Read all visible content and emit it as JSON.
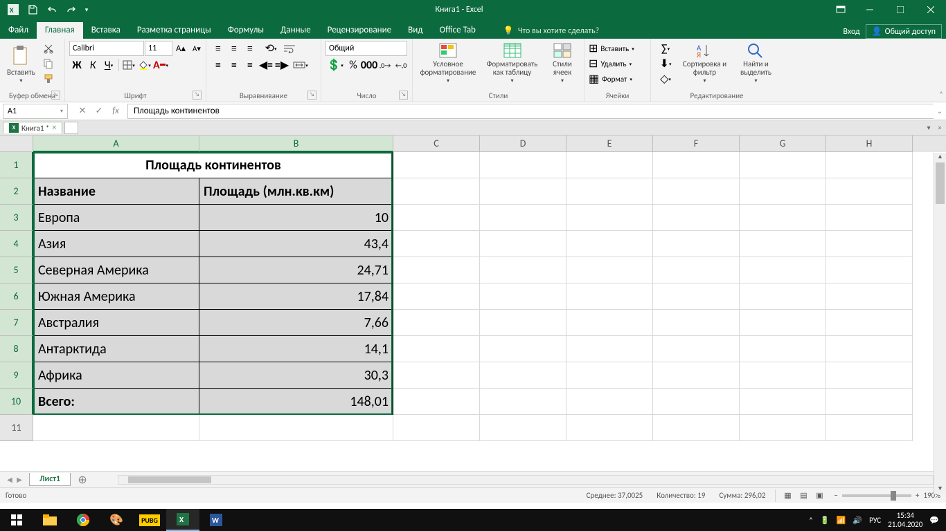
{
  "title": "Книга1 - Excel",
  "qat": {
    "sep": "▾"
  },
  "tabs": {
    "file": "Файл",
    "items": [
      "Главная",
      "Вставка",
      "Разметка страницы",
      "Формулы",
      "Данные",
      "Рецензирование",
      "Вид",
      "Office Tab"
    ],
    "active": 0,
    "tellme": "Что вы хотите сделать?",
    "signin": "Вход",
    "share": "Общий доступ"
  },
  "ribbon": {
    "clipboard": {
      "paste": "Вставить",
      "label": "Буфер обмена"
    },
    "font": {
      "name": "Calibri",
      "size": "11",
      "label": "Шрифт"
    },
    "align": {
      "label": "Выравнивание"
    },
    "number": {
      "fmt": "Общий",
      "label": "Число"
    },
    "styles": {
      "cond": "Условное форматирование",
      "table": "Форматировать как таблицу",
      "cell": "Стили ячеек",
      "label": "Стили"
    },
    "cells": {
      "insert": "Вставить",
      "delete": "Удалить",
      "format": "Формат",
      "label": "Ячейки"
    },
    "editing": {
      "sort": "Сортировка и фильтр",
      "find": "Найти и выделить",
      "label": "Редактирование"
    }
  },
  "namebox": "A1",
  "formula": "Площадь континентов",
  "wbtab": "Книга1 *",
  "cols": [
    "A",
    "B",
    "C",
    "D",
    "E",
    "F",
    "G",
    "H"
  ],
  "rows": [
    "1",
    "2",
    "3",
    "4",
    "5",
    "6",
    "7",
    "8",
    "9",
    "10",
    "11"
  ],
  "sheet": {
    "title": "Площадь континентов",
    "h1": "Название",
    "h2": "Площадь (млн.кв.км)",
    "data": [
      {
        "name": "Европа",
        "area": "10"
      },
      {
        "name": "Азия",
        "area": "43,4"
      },
      {
        "name": "Северная Америка",
        "area": "24,71"
      },
      {
        "name": "Южная Америка",
        "area": "17,84"
      },
      {
        "name": "Австралия",
        "area": "7,66"
      },
      {
        "name": "Антарктида",
        "area": "14,1"
      },
      {
        "name": "Африка",
        "area": "30,3"
      }
    ],
    "total_label": "Всего:",
    "total": "148,01"
  },
  "sheettab": "Лист1",
  "status": {
    "ready": "Готово",
    "avg_label": "Среднее:",
    "avg": "37,0025",
    "count_label": "Количество:",
    "count": "19",
    "sum_label": "Сумма:",
    "sum": "296,02",
    "zoom": "190%"
  },
  "tray": {
    "lang": "РУС",
    "time": "15:34",
    "date": "21.04.2020"
  }
}
